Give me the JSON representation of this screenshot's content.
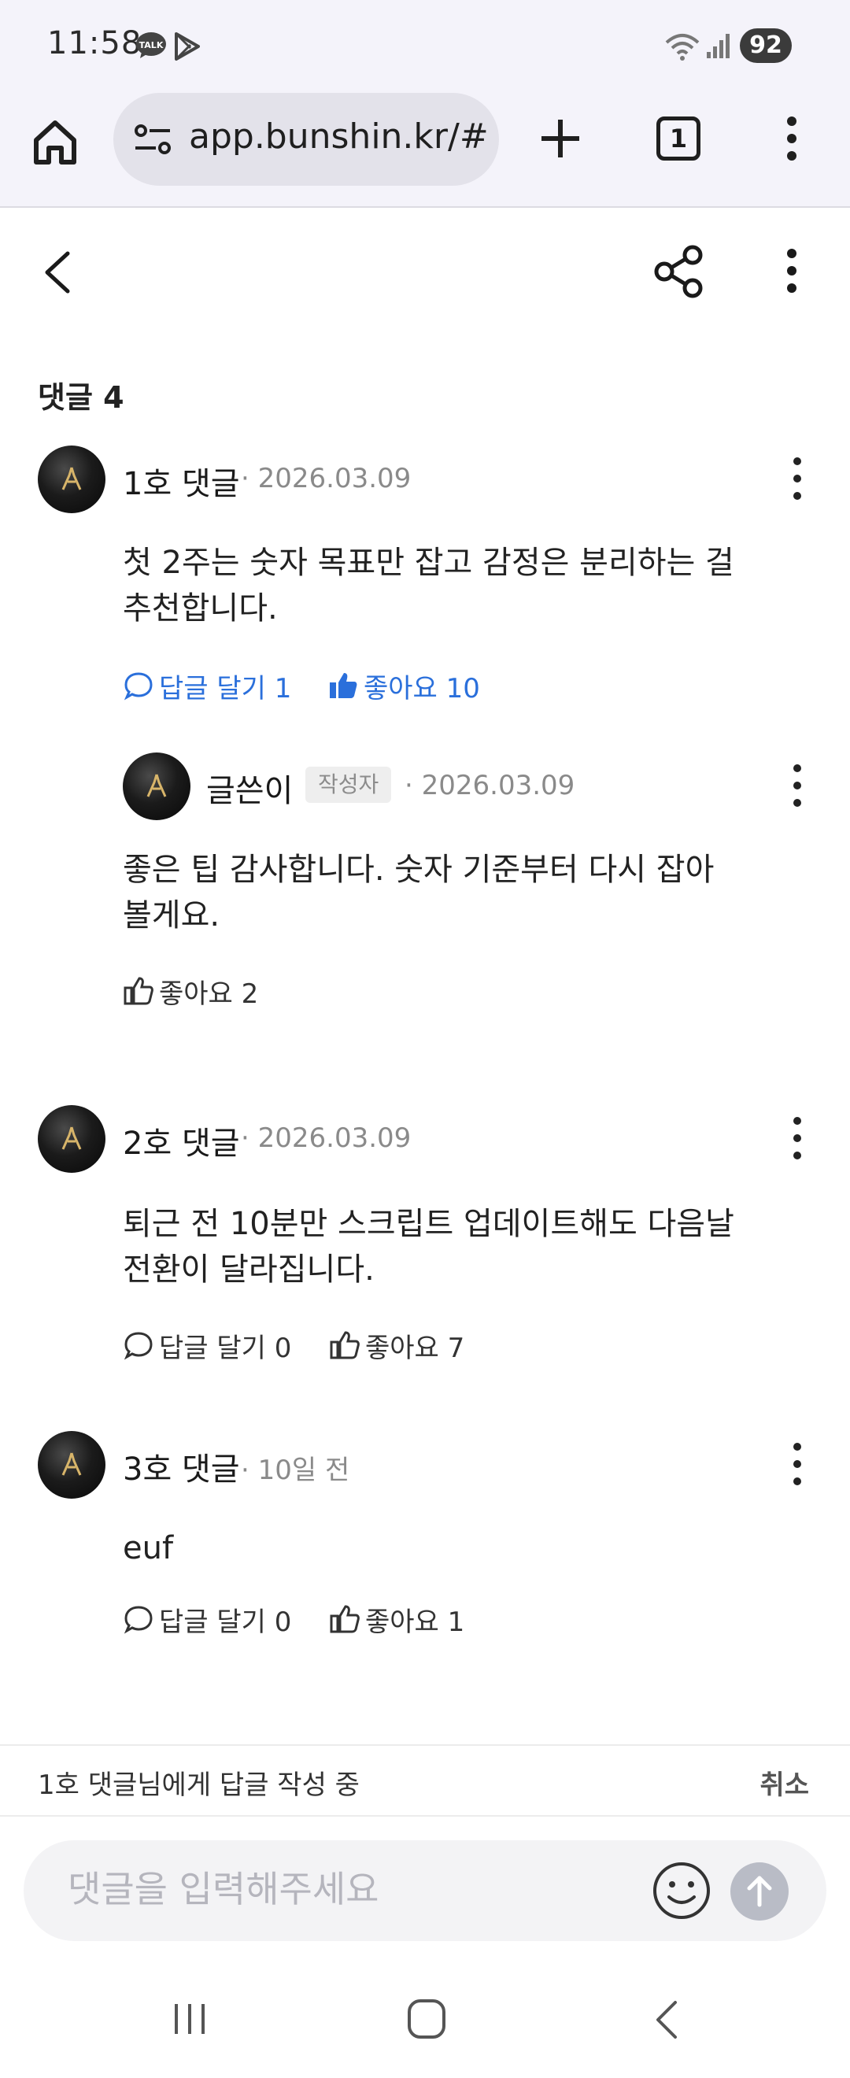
{
  "status_bar": {
    "time": "11:58",
    "battery": "92",
    "icons": [
      "kakaotalk-icon",
      "play-store-icon",
      "wifi-icon",
      "signal-icon"
    ]
  },
  "browser": {
    "url": "app.bunshin.kr/#",
    "tab_count": "1"
  },
  "page": {
    "comment_count_label": "댓글 4"
  },
  "comments": [
    {
      "author": "1호 댓글",
      "date": "· 2026.03.09",
      "text": "첫 2주는 숫자 목표만 잡고 감정은 분리하는 걸 추천합니다.",
      "reply_label": "답글 달기 1",
      "like_label": "좋아요 10",
      "liked": true
    },
    {
      "author": "글쓴이",
      "badge": "작성자",
      "date": "· 2026.03.09",
      "text": "좋은 팁 감사합니다. 숫자 기준부터 다시 잡아볼게요.",
      "like_label": "좋아요 2",
      "is_reply": true
    },
    {
      "author": "2호 댓글",
      "date": "· 2026.03.09",
      "text": "퇴근 전 10분만 스크립트 업데이트해도 다음날 전환이 달라집니다.",
      "reply_label": "답글 달기 0",
      "like_label": "좋아요 7"
    },
    {
      "author": "3호 댓글",
      "date": "· 10일 전",
      "text": "euf",
      "reply_label": "답글 달기 0",
      "like_label": "좋아요 1"
    }
  ],
  "reply_bar": {
    "text": "1호 댓글님에게 답글 작성 중",
    "cancel": "취소"
  },
  "composer": {
    "placeholder": "댓글을 입력해주세요"
  },
  "colors": {
    "accent_blue": "#2a6fdb",
    "chrome_bg": "#f4f3fa",
    "send_button": "#b9bcc6"
  }
}
